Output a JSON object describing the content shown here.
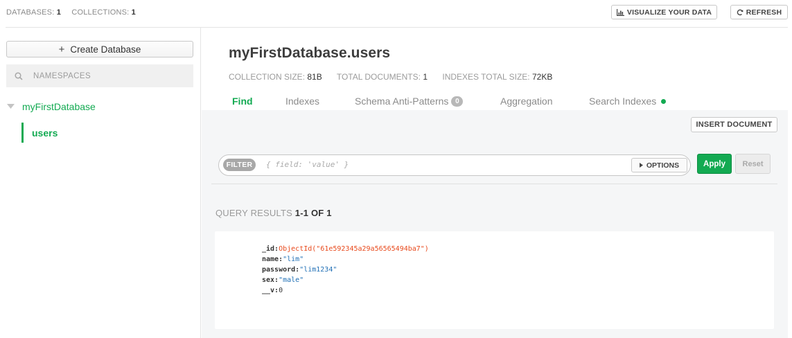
{
  "topbar": {
    "databases_label": "DATABASES:",
    "databases_count": "1",
    "collections_label": "COLLECTIONS:",
    "collections_count": "1",
    "visualize_label": "VISUALIZE YOUR DATA",
    "refresh_label": "REFRESH"
  },
  "sidebar": {
    "create_db_label": "Create Database",
    "namespace_placeholder": "NAMESPACES",
    "databases": [
      {
        "name": "myFirstDatabase",
        "collections": [
          "users"
        ]
      }
    ]
  },
  "collection": {
    "title": "myFirstDatabase.users",
    "size_label": "COLLECTION SIZE:",
    "size_value": "81B",
    "docs_label": "TOTAL DOCUMENTS:",
    "docs_value": "1",
    "indexes_label": "INDEXES TOTAL SIZE:",
    "indexes_value": "72KB"
  },
  "tabs": [
    {
      "label": "Find",
      "active": true
    },
    {
      "label": "Indexes"
    },
    {
      "label": "Schema Anti-Patterns",
      "badge": "0"
    },
    {
      "label": "Aggregation"
    },
    {
      "label": "Search Indexes"
    }
  ],
  "find": {
    "insert_label": "INSERT DOCUMENT",
    "filter_pill": "FILTER",
    "filter_placeholder": "{ field: 'value' }",
    "options_label": "OPTIONS",
    "apply_label": "Apply",
    "reset_label": "Reset",
    "results_label": "QUERY RESULTS",
    "results_range": "1-1 OF 1"
  },
  "document": {
    "id_key": "_id:",
    "id_value": "ObjectId(\"61e592345a29a56565494ba7\")",
    "name_key": "name:",
    "name_value": "\"lim\"",
    "password_key": "password:",
    "password_value": "\"lim1234\"",
    "sex_key": "sex:",
    "sex_value": "\"male\"",
    "v_key": "__v:",
    "v_value": "0"
  },
  "colors": {
    "accent": "#13aa52",
    "objectid": "#e8491c",
    "string": "#1f6fb5"
  }
}
